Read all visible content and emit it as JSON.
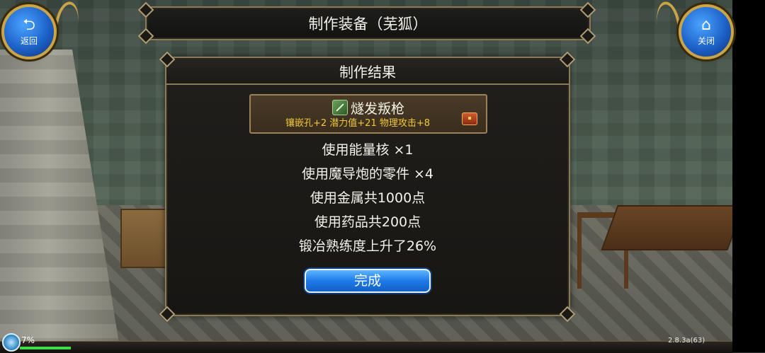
{
  "header": {
    "title": "制作装备（芜狐）"
  },
  "nav": {
    "back_label": "返回",
    "back_icon": "return-arrow-icon",
    "close_label": "关闭",
    "close_icon": "home-icon"
  },
  "dialog": {
    "title": "制作结果",
    "item": {
      "name": "燧发叛枪",
      "stats": "镶嵌孔+2 潜力值+21 物理攻击+8",
      "icon": "spear-icon",
      "badge_icon": "chest-icon"
    },
    "lines": [
      "使用能量核 ×1",
      "使用魔导炮的零件 ×4",
      "使用金属共1000点",
      "使用药品共200点",
      "锻冶熟练度上升了26%"
    ],
    "confirm_label": "完成"
  },
  "status": {
    "loading_percent_text": "7%",
    "loading_progress": 0.07,
    "version": "2.8.3a(63)"
  },
  "colors": {
    "stats_text": "#f0c93a",
    "button_blue": "#1f7ae8",
    "frame_gold": "#8b7a5a"
  }
}
